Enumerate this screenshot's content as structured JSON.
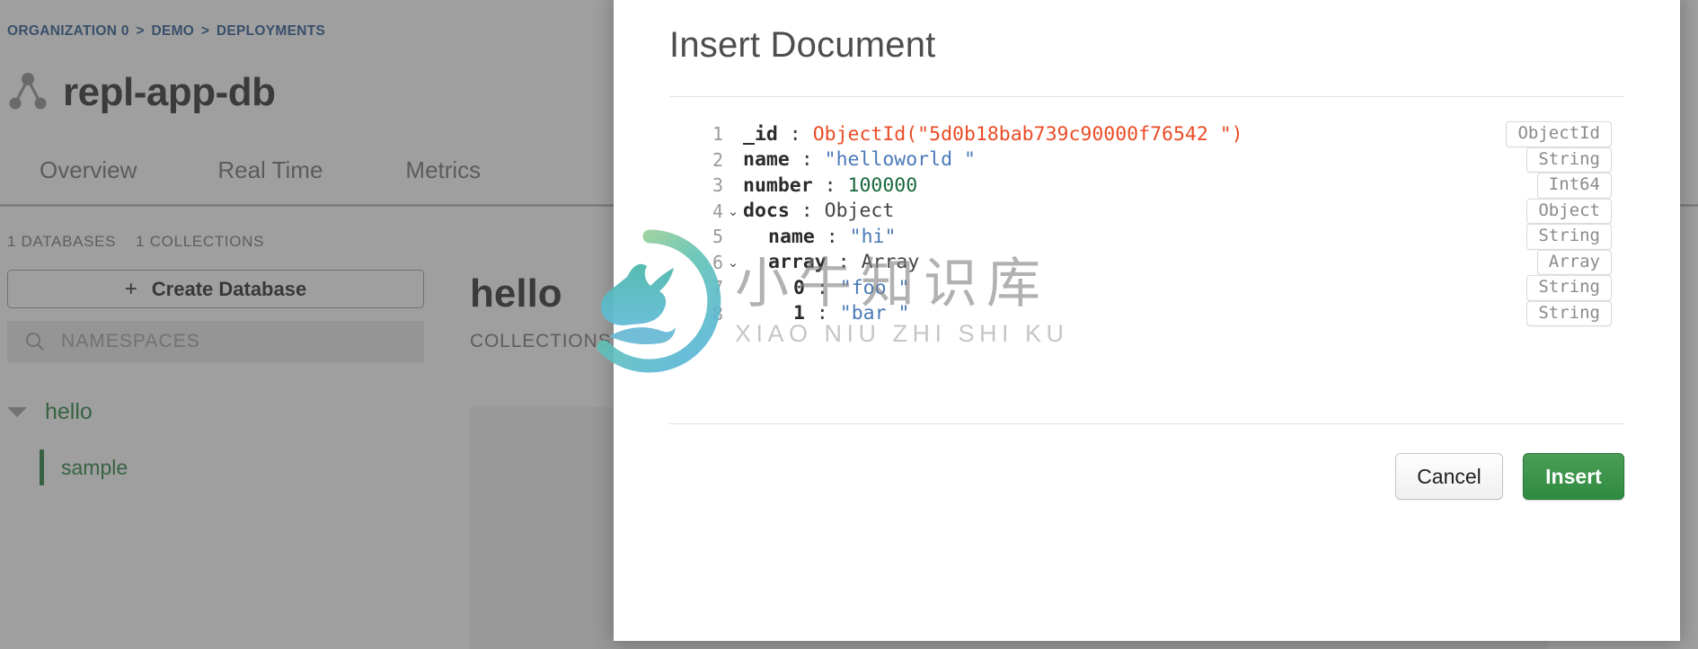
{
  "background": {
    "breadcrumb": {
      "items": [
        "ORGANIZATION 0",
        "DEMO",
        "DEPLOYMENTS"
      ],
      "separator": ">"
    },
    "cluster_name": "repl-app-db",
    "cluster_icon": "replica-set-icon",
    "tabs": [
      "Overview",
      "Real Time",
      "Metrics"
    ],
    "stats": {
      "databases": "1 DATABASES",
      "collections": "1 COLLECTIONS"
    },
    "create_database_label": "Create Database",
    "create_database_plus": "+",
    "namespaces_placeholder": "NAMESPACES",
    "tree": {
      "database": "hello",
      "collection": "sample"
    },
    "main": {
      "title": "hello",
      "subtitle": "COLLECTIONS"
    }
  },
  "watermark": {
    "chinese": "小牛知识库",
    "pinyin": "XIAO NIU ZHI SHI KU",
    "logo_name": "bull-logo"
  },
  "modal": {
    "title": "Insert Document",
    "editor": {
      "lines": [
        {
          "no": "1",
          "toggle": "",
          "indent": 0,
          "key": "_id",
          "sep": " : ",
          "value": "ObjectId(\"5d0b18bab739c90000f76542 \")",
          "value_kind": "oid",
          "type": "ObjectId"
        },
        {
          "no": "2",
          "toggle": "",
          "indent": 0,
          "key": "name",
          "sep": " : ",
          "value": "\"helloworld \"",
          "value_kind": "string",
          "type": "String"
        },
        {
          "no": "3",
          "toggle": "",
          "indent": 0,
          "key": "number",
          "sep": " : ",
          "value": "100000",
          "value_kind": "number",
          "type": "Int64"
        },
        {
          "no": "4",
          "toggle": "⌄",
          "indent": 0,
          "key": "docs",
          "sep": " : ",
          "value": "Object",
          "value_kind": "plain",
          "type": "Object"
        },
        {
          "no": "5",
          "toggle": "",
          "indent": 1,
          "key": "name",
          "sep": " : ",
          "value": "\"hi\"",
          "value_kind": "string",
          "type": "String"
        },
        {
          "no": "6",
          "toggle": "⌄",
          "indent": 1,
          "key": "array",
          "sep": " : ",
          "value": "Array",
          "value_kind": "plain",
          "type": "Array"
        },
        {
          "no": "7",
          "toggle": "",
          "indent": 2,
          "key": "0",
          "sep": " : ",
          "value": "\"foo \"",
          "value_kind": "string",
          "type": "String"
        },
        {
          "no": "8",
          "toggle": "",
          "indent": 2,
          "key": "1",
          "sep": " : ",
          "value": "\"bar \"",
          "value_kind": "string",
          "type": "String"
        }
      ]
    },
    "buttons": {
      "cancel": "Cancel",
      "insert": "Insert"
    }
  },
  "colors": {
    "breadcrumb_link": "#1b4f8a",
    "tree_green": "#1a7a34",
    "insert_green": "#2f8b40",
    "objectid_orange": "#ea4b26",
    "string_blue": "#4a7ab8",
    "number_green": "#17683a",
    "scrim": "#505050"
  }
}
